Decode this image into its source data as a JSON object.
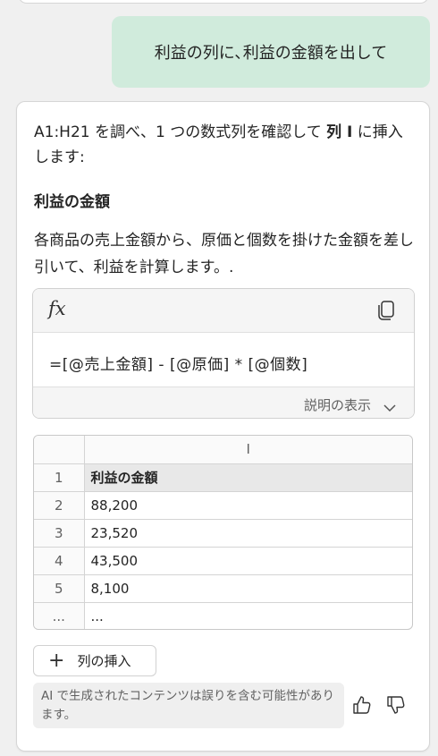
{
  "user_message": "利益の列に､利益の金額を出して",
  "response": {
    "intro_part1": "A1:H21 を調べ、1 つの数式列を確認して ",
    "intro_bold": "列 I",
    "intro_part2": " に挿入します:",
    "section_title": "利益の金額",
    "description": "各商品の売上金額から、原価と個数を掛けた金額を差し引いて、利益を計算します。.",
    "formula": {
      "fx_symbol": "fx",
      "text": "=[@売上金額] - [@原価] * [@個数]",
      "explain_label": "説明の表示"
    },
    "grid": {
      "column_header": "I",
      "rows": [
        {
          "num": "1",
          "value": "利益の金額"
        },
        {
          "num": "2",
          "value": "88,200"
        },
        {
          "num": "3",
          "value": "23,520"
        },
        {
          "num": "4",
          "value": "43,500"
        },
        {
          "num": "5",
          "value": "8,100"
        },
        {
          "num": "...",
          "value": "..."
        }
      ]
    },
    "insert_button_label": "列の挿入",
    "disclaimer": "AI で生成されたコンテンツは誤りを含む可能性があります。"
  },
  "colors": {
    "user_bubble": "#d0ebdc",
    "card_background": "#ffffff",
    "page_background": "#f0f0f0"
  },
  "icons": {
    "formula": "fx-icon",
    "copy": "copy-icon",
    "explain": "chevron-down-icon",
    "insert": "plus-icon",
    "feedback_positive": "thumbs-up-icon",
    "feedback_negative": "thumbs-down-icon"
  }
}
